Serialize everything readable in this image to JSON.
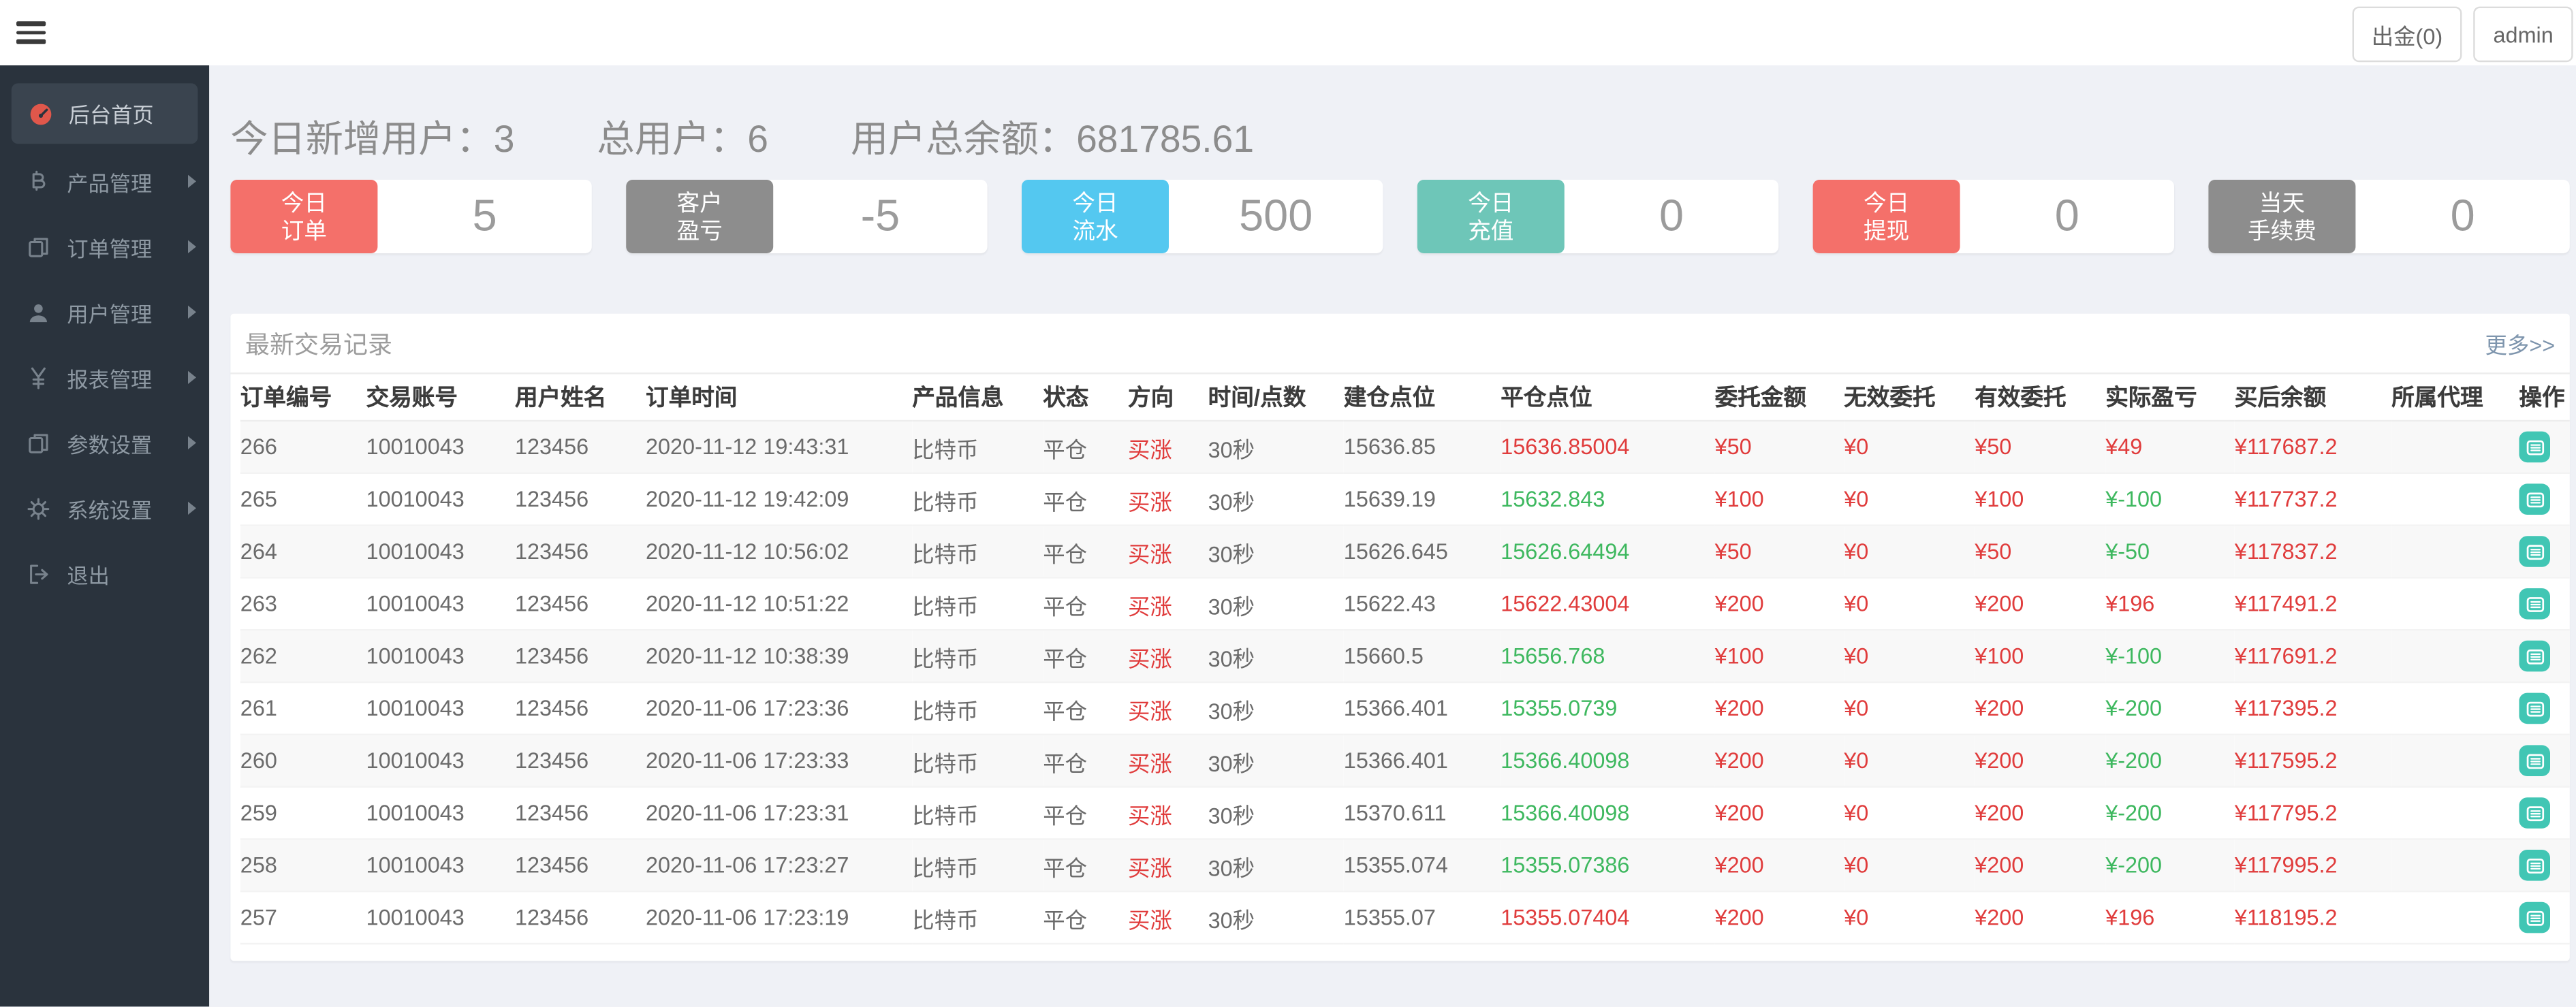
{
  "colors": {
    "page_bg": "#eff1f6",
    "sidebar_bg": "#2a333d",
    "sidebar_active_bg": "#3a444f",
    "icon_red": "#e0574b",
    "card_red": "#f4706a",
    "card_gray": "#8d8d8d",
    "card_blue": "#54c8f0",
    "card_teal": "#6ec6b8",
    "text_red": "#e03c3c",
    "text_green": "#3eb85f",
    "action_teal": "#41c6b4",
    "link_blue": "#7e95ad"
  },
  "topbar": {
    "withdraw_label": "出金(0)",
    "user_label": "admin"
  },
  "sidebar": {
    "items": [
      {
        "key": "home",
        "label": "后台首页",
        "icon": "dashboard-icon",
        "active": true,
        "arrow": false
      },
      {
        "key": "products",
        "label": "产品管理",
        "icon": "bitcoin-icon",
        "active": false,
        "arrow": true
      },
      {
        "key": "orders",
        "label": "订单管理",
        "icon": "orders-icon",
        "active": false,
        "arrow": true
      },
      {
        "key": "users",
        "label": "用户管理",
        "icon": "user-icon",
        "active": false,
        "arrow": true
      },
      {
        "key": "reports",
        "label": "报表管理",
        "icon": "yen-icon",
        "active": false,
        "arrow": true
      },
      {
        "key": "params",
        "label": "参数设置",
        "icon": "params-icon",
        "active": false,
        "arrow": true
      },
      {
        "key": "system",
        "label": "系统设置",
        "icon": "gear-icon",
        "active": false,
        "arrow": true
      },
      {
        "key": "logout",
        "label": "退出",
        "icon": "logout-icon",
        "active": false,
        "arrow": false
      }
    ]
  },
  "stats": [
    {
      "label": "今日新增用户：",
      "value": "3"
    },
    {
      "label": "总用户：",
      "value": "6"
    },
    {
      "label": "用户总余额：",
      "value": "681785.61"
    }
  ],
  "cards": [
    {
      "key": "today-orders",
      "lines": [
        "今日",
        "订单"
      ],
      "value": "5",
      "color": "red"
    },
    {
      "key": "customer-pnl",
      "lines": [
        "客户",
        "盈亏"
      ],
      "value": "-5",
      "color": "gray"
    },
    {
      "key": "today-flow",
      "lines": [
        "今日",
        "流水"
      ],
      "value": "500",
      "color": "blue"
    },
    {
      "key": "today-recharge",
      "lines": [
        "今日",
        "充值"
      ],
      "value": "0",
      "color": "teal"
    },
    {
      "key": "today-withdraw",
      "lines": [
        "今日",
        "提现"
      ],
      "value": "0",
      "color": "red"
    },
    {
      "key": "today-fee",
      "lines": [
        "当天",
        "手续费"
      ],
      "value": "0",
      "color": "gray"
    }
  ],
  "panel": {
    "title": "最新交易记录",
    "more_link": "更多>>"
  },
  "table": {
    "columns": [
      "订单编号",
      "交易账号",
      "用户姓名",
      "订单时间",
      "产品信息",
      "状态",
      "方向",
      "时间/点数",
      "建仓点位",
      "平仓点位",
      "委托金额",
      "无效委托",
      "有效委托",
      "实际盈亏",
      "买后余额",
      "所属代理",
      "操作"
    ],
    "rows": [
      {
        "id": "266",
        "account": "10010043",
        "name": "123456",
        "time": "2020-11-12 19:43:31",
        "product": "比特币",
        "status": "平仓",
        "direction": "买涨",
        "duration": "30秒",
        "open": "15636.85",
        "close": "15636.85004",
        "close_color": "red",
        "amount": "¥50",
        "invalid": "¥0",
        "valid": "¥50",
        "profit": "¥49",
        "profit_color": "red",
        "balance": "¥117687.2",
        "agent": ""
      },
      {
        "id": "265",
        "account": "10010043",
        "name": "123456",
        "time": "2020-11-12 19:42:09",
        "product": "比特币",
        "status": "平仓",
        "direction": "买涨",
        "duration": "30秒",
        "open": "15639.19",
        "close": "15632.843",
        "close_color": "green",
        "amount": "¥100",
        "invalid": "¥0",
        "valid": "¥100",
        "profit": "¥-100",
        "profit_color": "green",
        "balance": "¥117737.2",
        "agent": ""
      },
      {
        "id": "264",
        "account": "10010043",
        "name": "123456",
        "time": "2020-11-12 10:56:02",
        "product": "比特币",
        "status": "平仓",
        "direction": "买涨",
        "duration": "30秒",
        "open": "15626.645",
        "close": "15626.64494",
        "close_color": "green",
        "amount": "¥50",
        "invalid": "¥0",
        "valid": "¥50",
        "profit": "¥-50",
        "profit_color": "green",
        "balance": "¥117837.2",
        "agent": ""
      },
      {
        "id": "263",
        "account": "10010043",
        "name": "123456",
        "time": "2020-11-12 10:51:22",
        "product": "比特币",
        "status": "平仓",
        "direction": "买涨",
        "duration": "30秒",
        "open": "15622.43",
        "close": "15622.43004",
        "close_color": "red",
        "amount": "¥200",
        "invalid": "¥0",
        "valid": "¥200",
        "profit": "¥196",
        "profit_color": "red",
        "balance": "¥117491.2",
        "agent": ""
      },
      {
        "id": "262",
        "account": "10010043",
        "name": "123456",
        "time": "2020-11-12 10:38:39",
        "product": "比特币",
        "status": "平仓",
        "direction": "买涨",
        "duration": "30秒",
        "open": "15660.5",
        "close": "15656.768",
        "close_color": "green",
        "amount": "¥100",
        "invalid": "¥0",
        "valid": "¥100",
        "profit": "¥-100",
        "profit_color": "green",
        "balance": "¥117691.2",
        "agent": ""
      },
      {
        "id": "261",
        "account": "10010043",
        "name": "123456",
        "time": "2020-11-06 17:23:36",
        "product": "比特币",
        "status": "平仓",
        "direction": "买涨",
        "duration": "30秒",
        "open": "15366.401",
        "close": "15355.0739",
        "close_color": "green",
        "amount": "¥200",
        "invalid": "¥0",
        "valid": "¥200",
        "profit": "¥-200",
        "profit_color": "green",
        "balance": "¥117395.2",
        "agent": ""
      },
      {
        "id": "260",
        "account": "10010043",
        "name": "123456",
        "time": "2020-11-06 17:23:33",
        "product": "比特币",
        "status": "平仓",
        "direction": "买涨",
        "duration": "30秒",
        "open": "15366.401",
        "close": "15366.40098",
        "close_color": "green",
        "amount": "¥200",
        "invalid": "¥0",
        "valid": "¥200",
        "profit": "¥-200",
        "profit_color": "green",
        "balance": "¥117595.2",
        "agent": ""
      },
      {
        "id": "259",
        "account": "10010043",
        "name": "123456",
        "time": "2020-11-06 17:23:31",
        "product": "比特币",
        "status": "平仓",
        "direction": "买涨",
        "duration": "30秒",
        "open": "15370.611",
        "close": "15366.40098",
        "close_color": "green",
        "amount": "¥200",
        "invalid": "¥0",
        "valid": "¥200",
        "profit": "¥-200",
        "profit_color": "green",
        "balance": "¥117795.2",
        "agent": ""
      },
      {
        "id": "258",
        "account": "10010043",
        "name": "123456",
        "time": "2020-11-06 17:23:27",
        "product": "比特币",
        "status": "平仓",
        "direction": "买涨",
        "duration": "30秒",
        "open": "15355.074",
        "close": "15355.07386",
        "close_color": "green",
        "amount": "¥200",
        "invalid": "¥0",
        "valid": "¥200",
        "profit": "¥-200",
        "profit_color": "green",
        "balance": "¥117995.2",
        "agent": ""
      },
      {
        "id": "257",
        "account": "10010043",
        "name": "123456",
        "time": "2020-11-06 17:23:19",
        "product": "比特币",
        "status": "平仓",
        "direction": "买涨",
        "duration": "30秒",
        "open": "15355.07",
        "close": "15355.07404",
        "close_color": "red",
        "amount": "¥200",
        "invalid": "¥0",
        "valid": "¥200",
        "profit": "¥196",
        "profit_color": "red",
        "balance": "¥118195.2",
        "agent": ""
      }
    ]
  }
}
